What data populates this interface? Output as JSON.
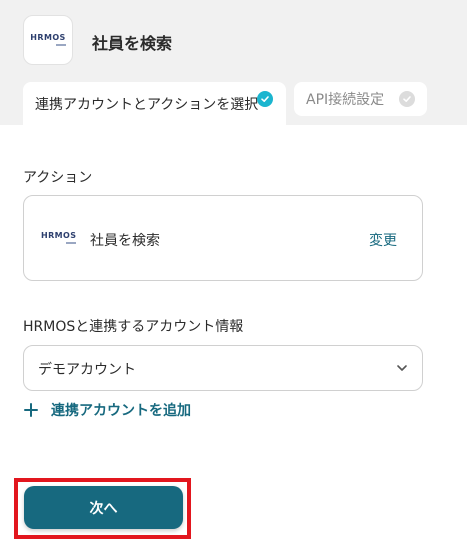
{
  "header": {
    "app_logo_text": "HRMOS",
    "title": "社員を検索"
  },
  "tabs": [
    {
      "label": "連携アカウントとアクションを選択",
      "completed": true
    },
    {
      "label": "API接続設定",
      "completed": false
    }
  ],
  "action_section": {
    "label": "アクション",
    "card": {
      "logo_text": "HRMOS",
      "action_name": "社員を検索",
      "change_label": "変更"
    }
  },
  "account_section": {
    "label": "HRMOSと連携するアカウント情報",
    "selected_account": "デモアカウント",
    "add_account_label": "連携アカウントを追加"
  },
  "footer": {
    "next_label": "次へ"
  },
  "colors": {
    "accent": "#17697f",
    "check_active": "#1bb5cf",
    "highlight": "#e2161e"
  }
}
